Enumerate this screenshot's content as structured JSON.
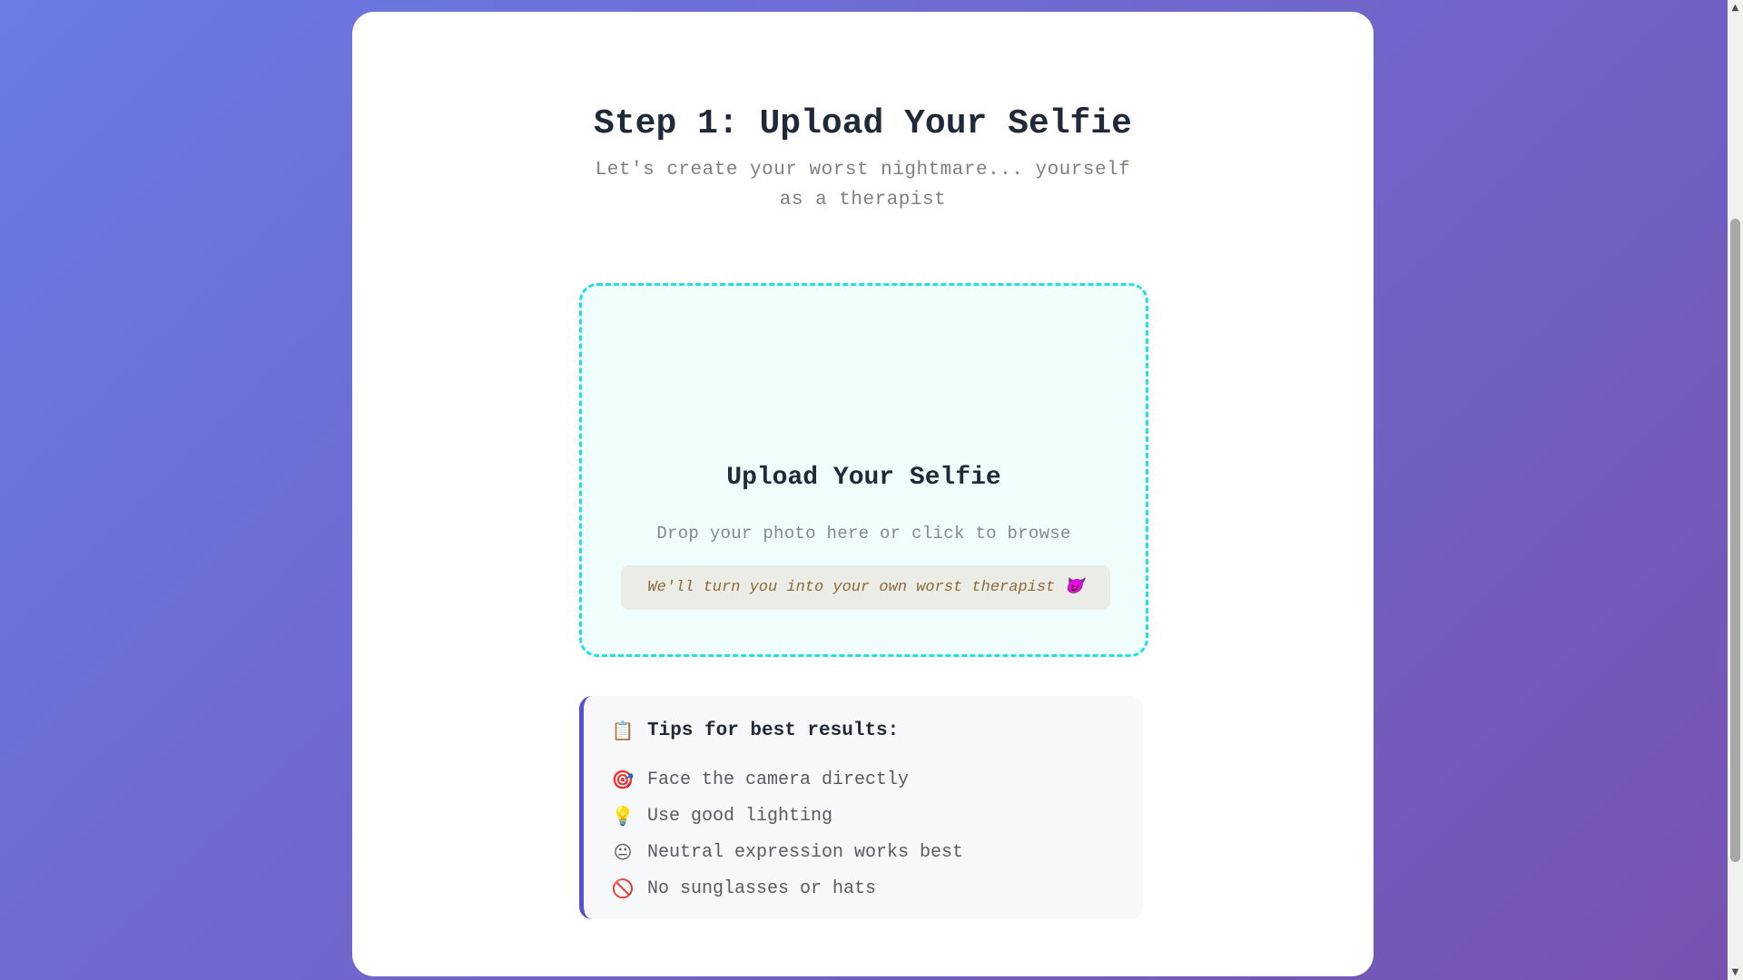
{
  "page": {
    "title": "Step 1: Upload Your Selfie",
    "subtitle": "Let's create your worst nightmare... yourself as a therapist"
  },
  "upload": {
    "title": "Upload Your Selfie",
    "instruction": "Drop your photo here or click to browse",
    "note": "We'll turn you into your own worst therapist 😈"
  },
  "tips": {
    "icon": "📋",
    "header": "Tips for best results:",
    "items": [
      {
        "icon": "🎯",
        "icon_name": "target-icon",
        "text": "Face the camera directly"
      },
      {
        "icon": "💡",
        "icon_name": "lightbulb-icon",
        "text": "Use good lighting"
      },
      {
        "icon": "😐",
        "icon_name": "neutral-face-icon",
        "text": "Neutral expression works best"
      },
      {
        "icon": "🚫",
        "icon_name": "prohibited-icon",
        "text": "No sunglasses or hats"
      }
    ]
  },
  "scrollbar": {
    "up_glyph": "▲",
    "down_glyph": "▼"
  },
  "colors": {
    "background_start": "#6a7ae6",
    "background_end": "#7652b0",
    "dropzone_border": "#22e0e0",
    "tips_accent": "#5a4fd1"
  }
}
